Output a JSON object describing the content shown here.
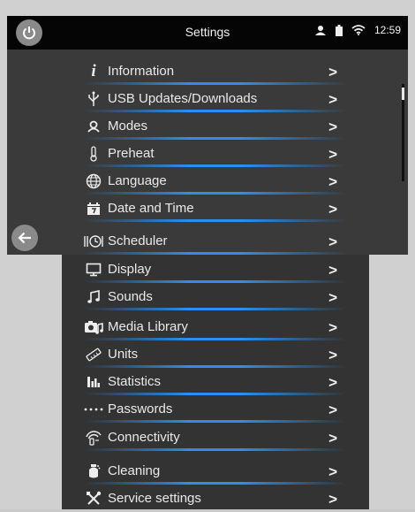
{
  "header": {
    "title": "Settings",
    "time": "12:59",
    "icons": [
      "power-icon",
      "user-icon",
      "battery-icon",
      "wifi-icon"
    ]
  },
  "menu": {
    "items": [
      {
        "label": "Information",
        "icon": "info-icon"
      },
      {
        "label": "USB Updates/Downloads",
        "icon": "usb-icon"
      },
      {
        "label": "Modes",
        "icon": "modes-icon"
      },
      {
        "label": "Preheat",
        "icon": "thermometer-icon"
      },
      {
        "label": "Language",
        "icon": "globe-icon"
      },
      {
        "label": "Date and Time",
        "icon": "calendar-icon"
      },
      {
        "label": "Scheduler",
        "icon": "scheduler-icon"
      },
      {
        "label": "Display",
        "icon": "monitor-icon"
      },
      {
        "label": "Sounds",
        "icon": "music-note-icon"
      },
      {
        "label": "Media Library",
        "icon": "media-icon"
      },
      {
        "label": "Units",
        "icon": "ruler-icon"
      },
      {
        "label": "Statistics",
        "icon": "bar-chart-icon"
      },
      {
        "label": "Passwords",
        "icon": "password-icon"
      },
      {
        "label": "Connectivity",
        "icon": "connectivity-icon"
      },
      {
        "label": "Cleaning",
        "icon": "cleaning-icon"
      },
      {
        "label": "Service settings",
        "icon": "tools-icon"
      }
    ],
    "chevron": ">"
  },
  "colors": {
    "accent": "#2a8ff0",
    "background": "#3a3a3a",
    "topbar": "#050505"
  }
}
